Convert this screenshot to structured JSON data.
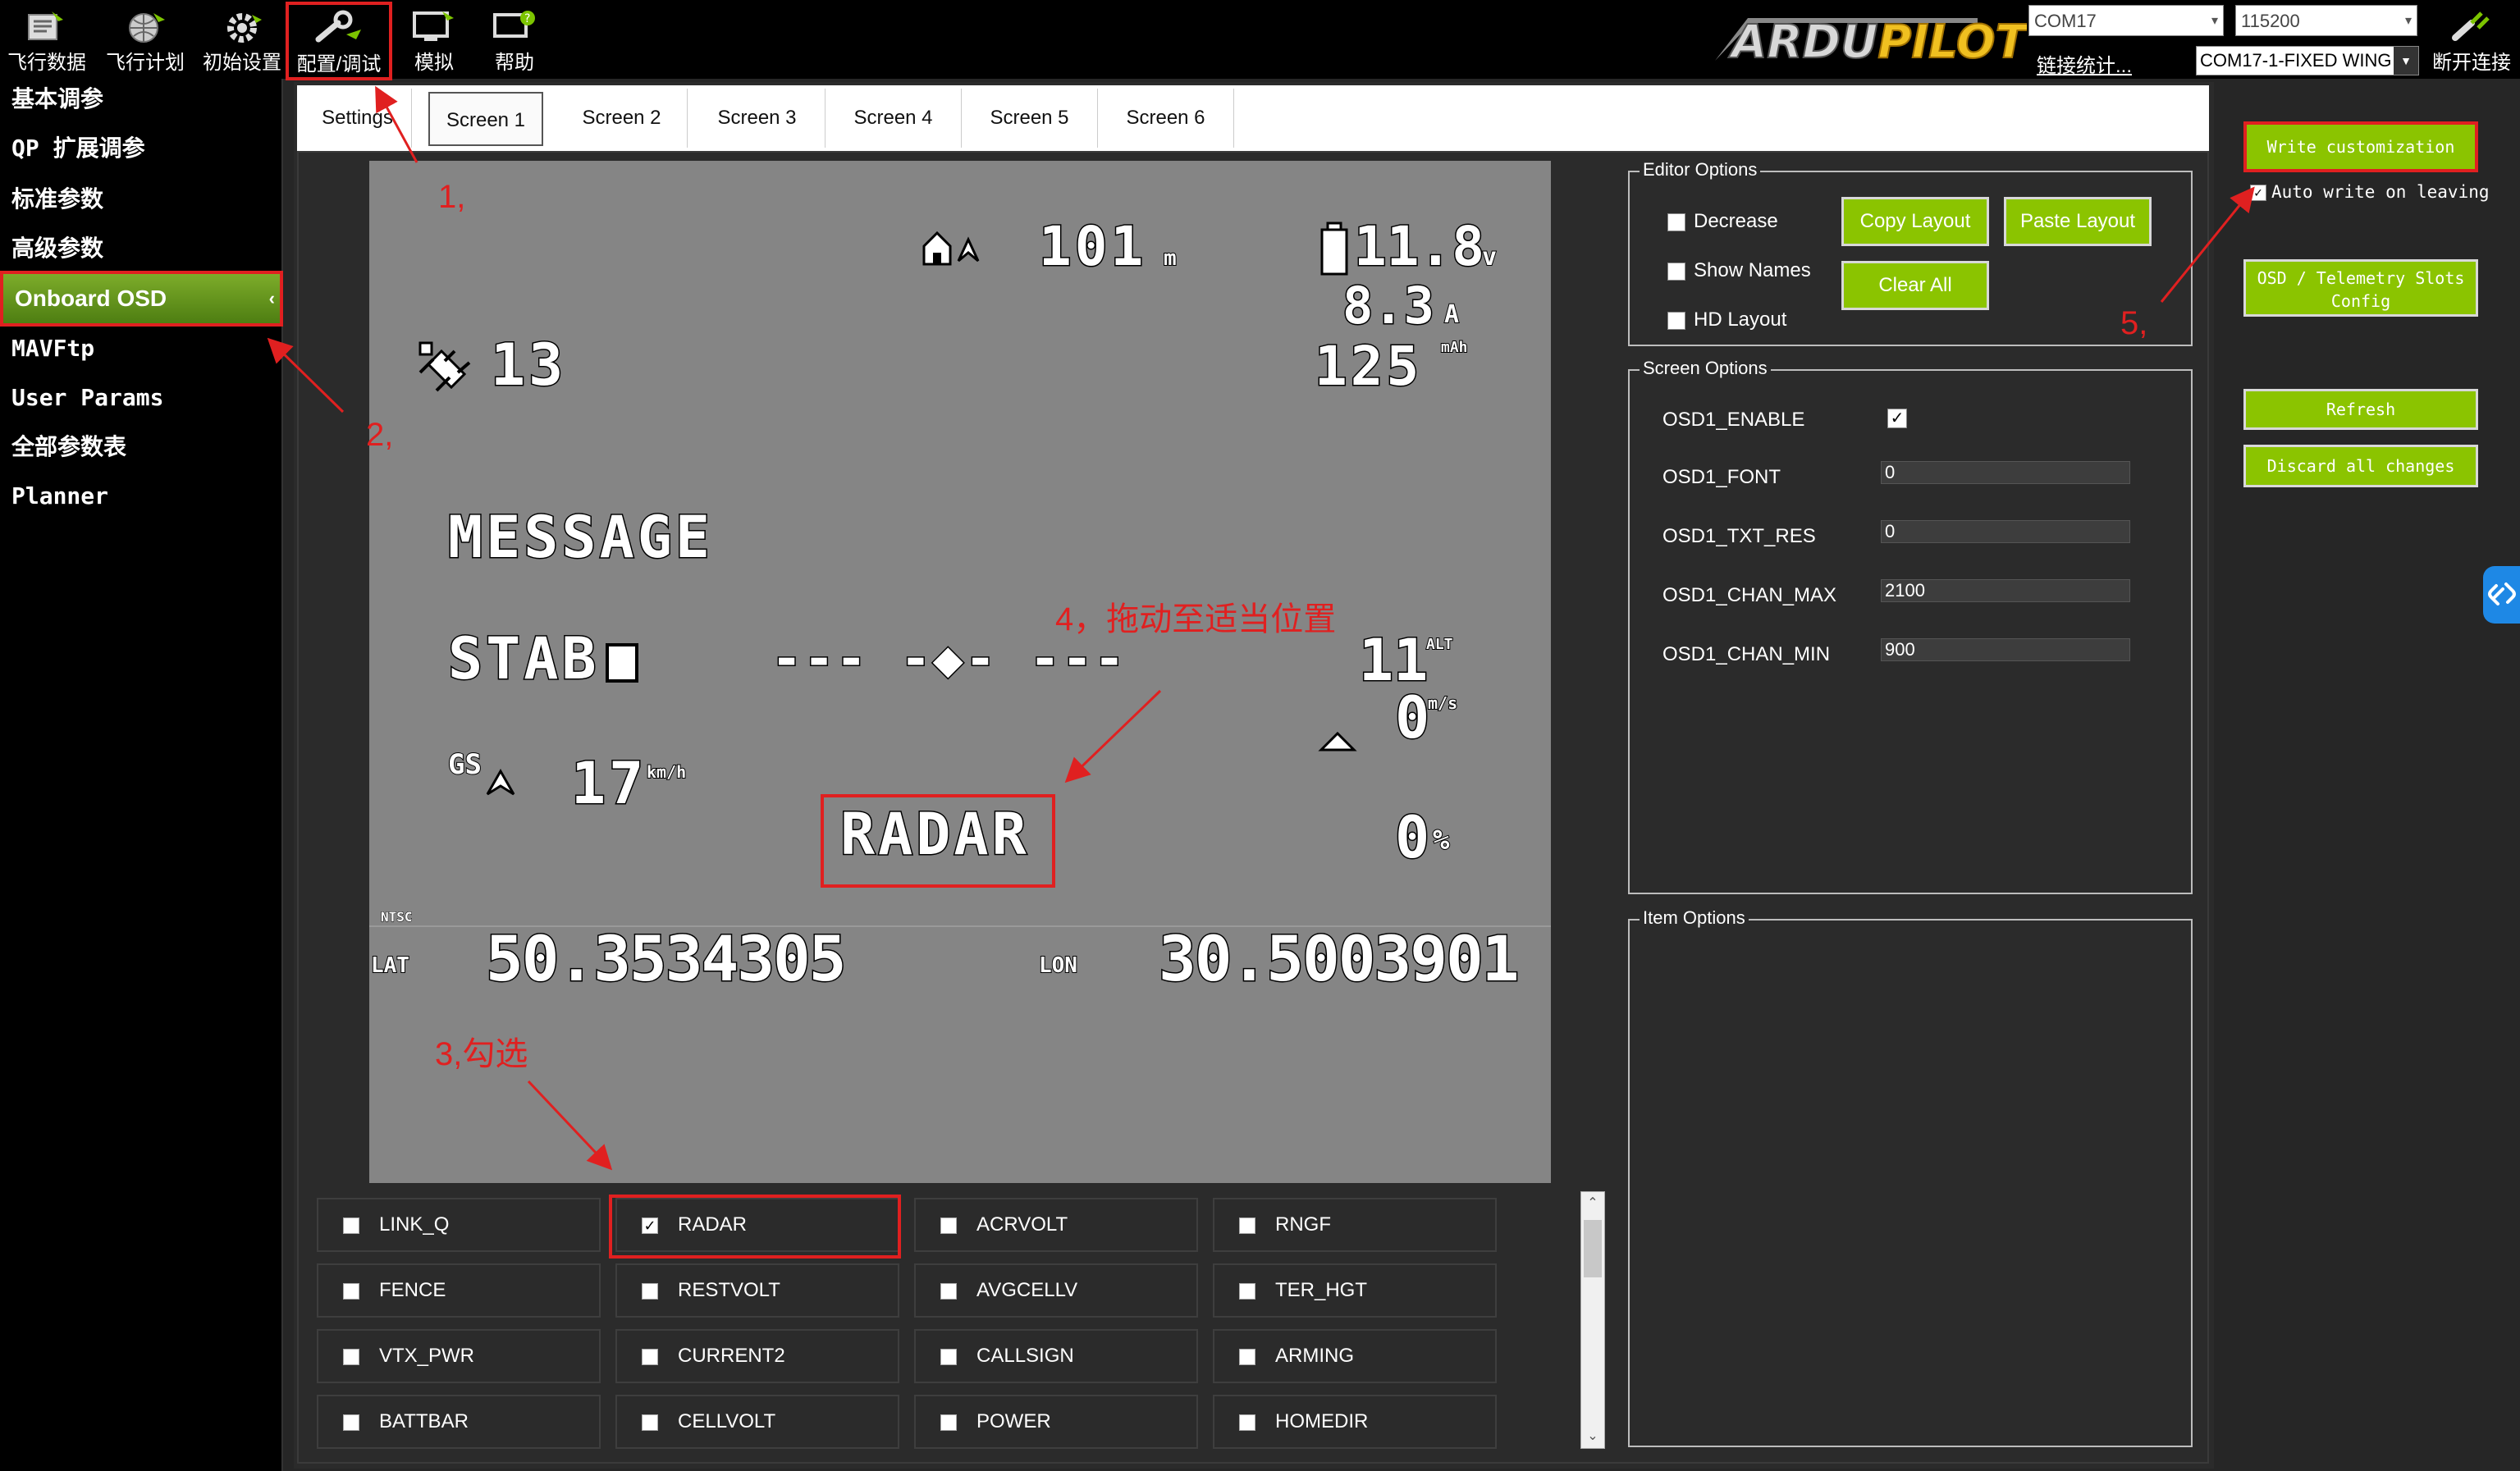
{
  "toolbar": {
    "items": [
      {
        "label": "飞行数据",
        "icon": "flight-data-icon"
      },
      {
        "label": "飞行计划",
        "icon": "flight-plan-icon"
      },
      {
        "label": "初始设置",
        "icon": "initial-setup-icon"
      },
      {
        "label": "配置/调试",
        "icon": "config-tuning-icon"
      },
      {
        "label": "模拟",
        "icon": "simulation-icon"
      },
      {
        "label": "帮助",
        "icon": "help-icon"
      }
    ],
    "disconnect_label": "断开连接",
    "logo_text": "ARDUPILOT",
    "port_combo": "COM17",
    "baud_combo": "115200",
    "link_stats": "链接统计...",
    "vehicle_combo": "COM17-1-FIXED WING"
  },
  "sidebar": {
    "items": [
      {
        "label": "基本调参"
      },
      {
        "label": "QP 扩展调参"
      },
      {
        "label": "标准参数"
      },
      {
        "label": "高级参数"
      },
      {
        "label": "Onboard OSD"
      },
      {
        "label": "MAVFtp"
      },
      {
        "label": "User Params"
      },
      {
        "label": "全部参数表"
      },
      {
        "label": "Planner"
      }
    ]
  },
  "tabs": [
    "Settings",
    "Screen 1",
    "Screen 2",
    "Screen 3",
    "Screen 4",
    "Screen 5",
    "Screen 6"
  ],
  "osd": {
    "home_alt": "101",
    "home_alt_unit": "m",
    "batt_volt": "11.8",
    "batt_volt_unit": "v",
    "current": "8.3",
    "current_unit": "A",
    "mah": "125",
    "mah_unit": "mAh",
    "sats": "13",
    "message": "MESSAGE",
    "mode": "STAB",
    "horizon": "--- -◆- ---",
    "alt": "11",
    "alt_unit": "ALT",
    "climb": "0",
    "climb_unit": "m/s",
    "gspd_prefix": "GS",
    "gspd": "17",
    "gspd_unit": "km/h",
    "radar": "RADAR",
    "throttle": "0",
    "throttle_unit": "%",
    "ntsc": "NTSC",
    "lat_label": "LAT",
    "lat": "50.3534305",
    "lon_label": "LON",
    "lon": "30.5003901"
  },
  "items": [
    {
      "label": "LINK_Q",
      "checked": false
    },
    {
      "label": "RADAR",
      "checked": true
    },
    {
      "label": "ACRVOLT",
      "checked": false
    },
    {
      "label": "RNGF",
      "checked": false
    },
    {
      "label": "FENCE",
      "checked": false
    },
    {
      "label": "RESTVOLT",
      "checked": false
    },
    {
      "label": "AVGCELLV",
      "checked": false
    },
    {
      "label": "TER_HGT",
      "checked": false
    },
    {
      "label": "VTX_PWR",
      "checked": false
    },
    {
      "label": "CURRENT2",
      "checked": false
    },
    {
      "label": "CALLSIGN",
      "checked": false
    },
    {
      "label": "ARMING",
      "checked": false
    },
    {
      "label": "BATTBAR",
      "checked": false
    },
    {
      "label": "CELLVOLT",
      "checked": false
    },
    {
      "label": "POWER",
      "checked": false
    },
    {
      "label": "HOMEDIR",
      "checked": false
    }
  ],
  "editor_options": {
    "title": "Editor Options",
    "decrease": "Decrease",
    "show_names": "Show Names",
    "hd_layout": "HD Layout",
    "copy_layout": "Copy Layout",
    "paste_layout": "Paste Layout",
    "clear_all": "Clear All"
  },
  "screen_options": {
    "title": "Screen Options",
    "rows": [
      {
        "name": "OSD1_ENABLE",
        "value": "",
        "checkbox": true
      },
      {
        "name": "OSD1_FONT",
        "value": "0"
      },
      {
        "name": "OSD1_TXT_RES",
        "value": "0"
      },
      {
        "name": "OSD1_CHAN_MAX",
        "value": "2100"
      },
      {
        "name": "OSD1_CHAN_MIN",
        "value": "900"
      }
    ]
  },
  "item_options": {
    "title": "Item Options"
  },
  "right": {
    "write_customization": "Write customization",
    "auto_write": "Auto write on leaving",
    "slots_config": "OSD / Telemetry Slots Config",
    "refresh": "Refresh",
    "discard": "Discard all changes"
  },
  "annotations": {
    "step1": "1,",
    "step2": "2,",
    "step3": "3,勾选",
    "step4": "4，拖动至适当位置",
    "step5": "5,"
  },
  "colors": {
    "accent_green": "#8bc400",
    "annotation_red": "#e02020",
    "osd_background": "#858585"
  }
}
